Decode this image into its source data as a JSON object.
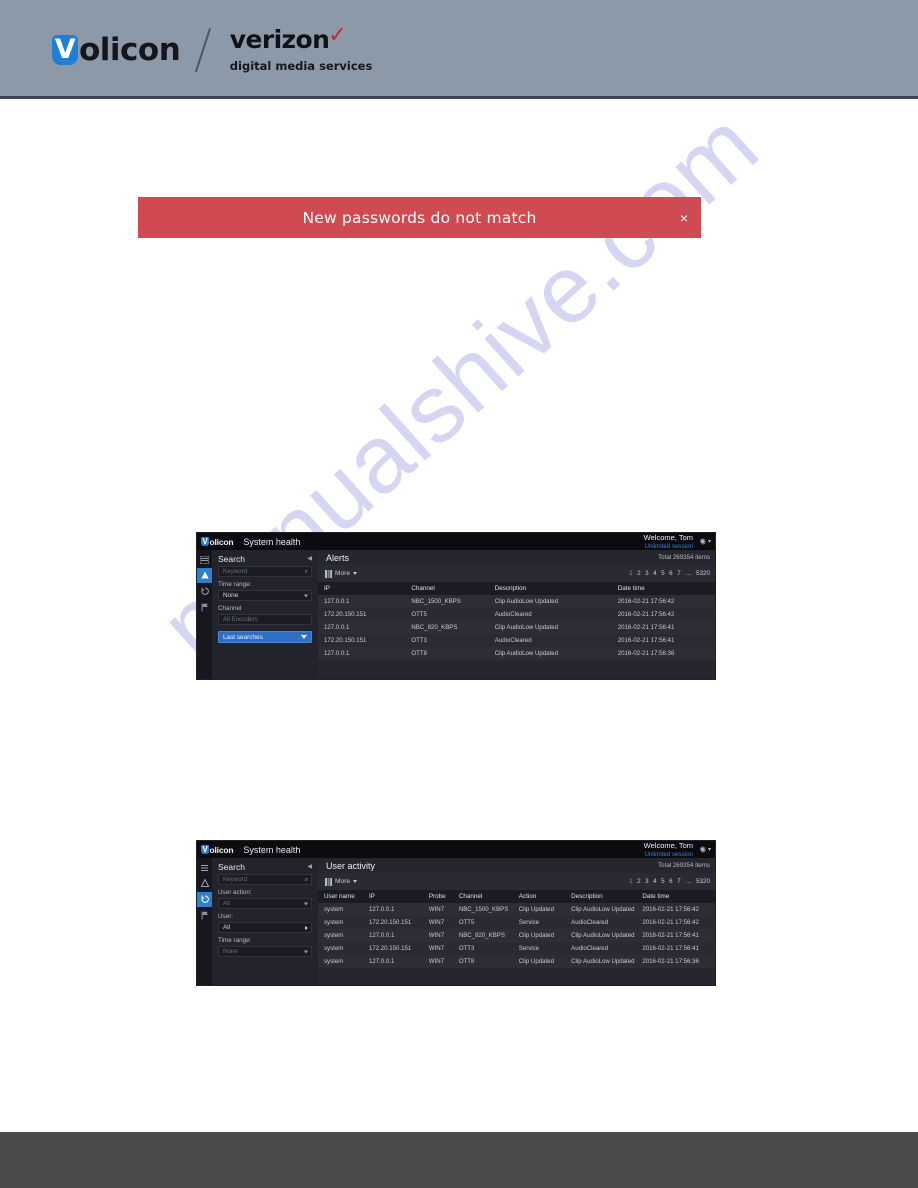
{
  "page_header": {
    "volicon_logo": {
      "initial": "V",
      "rest": "olicon"
    },
    "verizon_logo": {
      "word": "verizon",
      "check": "✓",
      "subtitle": "digital media services"
    }
  },
  "watermark": {
    "text": "manualshive.com"
  },
  "error_banner": {
    "message": "New passwords do not match",
    "close_label": "×"
  },
  "screenshots": [
    {
      "id": "alerts",
      "topbar": {
        "logo_initial": "V",
        "logo_rest": "olicon",
        "app_title": "System health",
        "welcome": "Welcome, Tom",
        "session": "Unlimited session",
        "gear_icon": "gear-icon",
        "gear_caret": "▾"
      },
      "rail": [
        {
          "icon": "menu-icon",
          "active": false
        },
        {
          "icon": "alert-bell-icon",
          "active": true
        },
        {
          "icon": "refresh-icon",
          "active": false
        },
        {
          "icon": "flag-icon",
          "active": false
        }
      ],
      "search_panel": {
        "title": "Search",
        "collapse_icon": "collapse-left-icon",
        "keyword_placeholder": "Keyword",
        "search_icon": "search-icon",
        "fields": [
          {
            "label": "Time range:",
            "value": "None",
            "kind": "dropdown",
            "muted": false
          },
          {
            "label": "Channel",
            "value": "All Encoders",
            "kind": "input",
            "muted": true
          }
        ],
        "last_searches_label": "Last searches"
      },
      "content": {
        "heading": "Alerts",
        "total": "Total 269354 items",
        "toolbar": {
          "columns_icon": "columns-icon",
          "more_label": "More"
        },
        "pager": [
          "1",
          "2",
          "3",
          "4",
          "5",
          "6",
          "7",
          "…",
          "5320"
        ],
        "columns": [
          "IP",
          "Channel",
          "Description",
          "Date time"
        ],
        "rows": [
          [
            "127.0.0.1",
            "NBC_1500_KBPS",
            "Clip AudioLow Updated",
            "2016-02-21 17:56:42"
          ],
          [
            "172.20.150.151",
            "OTT5",
            "AudioCleared",
            "2016-02-21 17:56:42"
          ],
          [
            "127.0.0.1",
            "NBC_820_KBPS",
            "Clip AudioLow Updated",
            "2016-02-21 17:56:41"
          ],
          [
            "172.20.150.151",
            "OTT3",
            "AudioCleared",
            "2016-02-21 17:56:41"
          ],
          [
            "127.0.0.1",
            "OTT8",
            "Clip AudioLow Updated",
            "2016-02-21 17:56:36"
          ]
        ]
      }
    },
    {
      "id": "user-activity",
      "topbar": {
        "logo_initial": "V",
        "logo_rest": "olicon",
        "app_title": "System health",
        "welcome": "Welcome, Tom",
        "session": "Unlimited session",
        "gear_icon": "gear-icon",
        "gear_caret": "▾"
      },
      "rail": [
        {
          "icon": "menu-icon",
          "active": false
        },
        {
          "icon": "alert-bell-icon",
          "active": false
        },
        {
          "icon": "refresh-icon",
          "active": true
        },
        {
          "icon": "flag-icon",
          "active": false
        }
      ],
      "search_panel": {
        "title": "Search",
        "collapse_icon": "collapse-left-icon",
        "keyword_placeholder": "Keyword",
        "search_icon": "search-icon",
        "fields": [
          {
            "label": "User action:",
            "value": "All",
            "kind": "dropdown",
            "muted": true
          },
          {
            "label": "User:",
            "value": "All",
            "kind": "arrow-right",
            "muted": false
          },
          {
            "label": "Time range:",
            "value": "None",
            "kind": "dropdown",
            "muted": true
          }
        ]
      },
      "content": {
        "heading": "User activity",
        "total": "Total 269354 items",
        "toolbar": {
          "columns_icon": "columns-icon",
          "more_label": "More"
        },
        "pager": [
          "1",
          "2",
          "3",
          "4",
          "5",
          "6",
          "7",
          "…",
          "5320"
        ],
        "columns": [
          "User name",
          "IP",
          "Probe",
          "Channel",
          "Action",
          "Description",
          "Date time"
        ],
        "rows": [
          [
            "system",
            "127.0.0.1",
            "WIN7",
            "NBC_1500_KBPS",
            "Clip Updated",
            "Clip AudioLow Updated",
            "2016-02-21 17:56:42"
          ],
          [
            "system",
            "172.20.150.151",
            "WIN7",
            "OTT5",
            "Service",
            "AudioCleared",
            "2016-02-21 17:56:42"
          ],
          [
            "system",
            "127.0.0.1",
            "WIN7",
            "NBC_820_KBPS",
            "Clip Updated",
            "Clip AudioLow Updated",
            "2016-02-21 17:56:41"
          ],
          [
            "system",
            "172.20.150.151",
            "WIN7",
            "OTT3",
            "Service",
            "AudioCleared",
            "2016-02-21 17:56:41"
          ],
          [
            "system",
            "127.0.0.1",
            "WIN7",
            "OTT8",
            "Clip Updated",
            "Clip AudioLow Updated",
            "2016-02-21 17:56:36"
          ]
        ]
      }
    }
  ],
  "colors": {
    "header_bg": "#8c99a9",
    "error_red": "#d04a52",
    "accent_blue": "#2f7fd0",
    "footer_gray": "#4c4a4a",
    "watermark": "#c9c9ee"
  }
}
